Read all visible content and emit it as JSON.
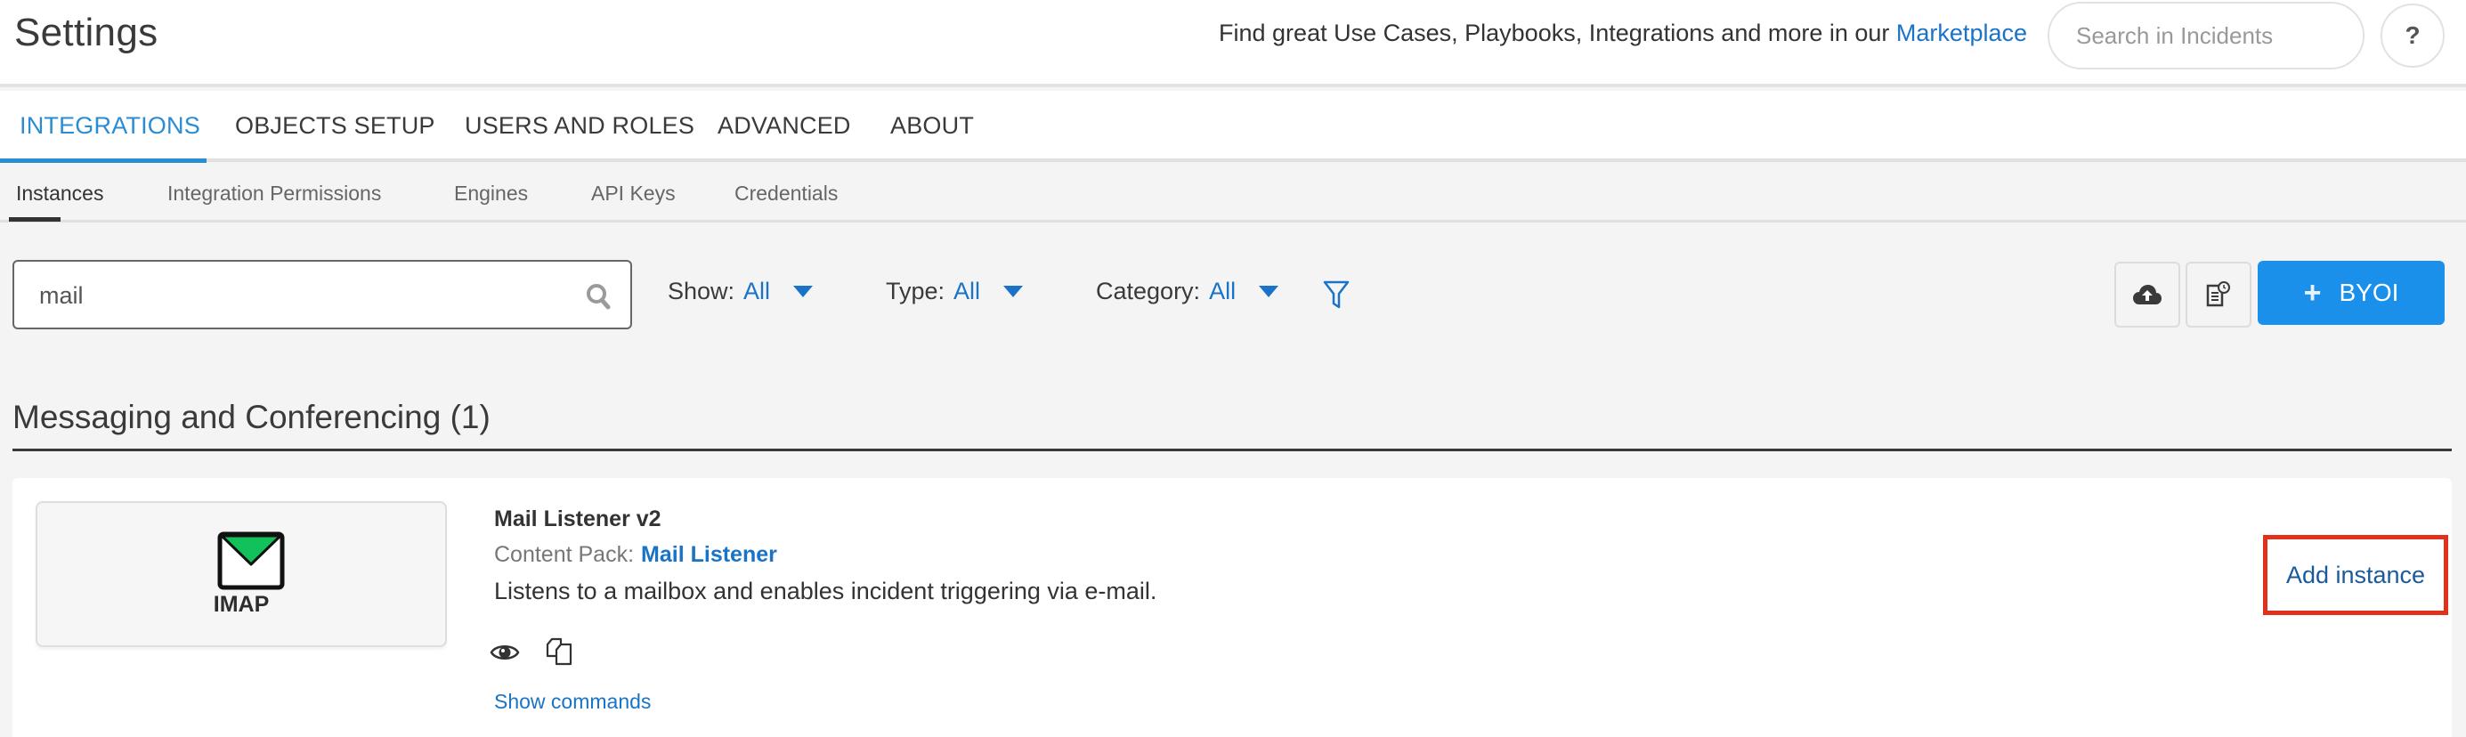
{
  "header": {
    "title": "Settings",
    "promo_text": "Find great Use Cases, Playbooks, Integrations and more in our ",
    "promo_link": "Marketplace",
    "search_placeholder": "Search in Incidents",
    "help_label": "?"
  },
  "main_tabs": [
    {
      "label": "INTEGRATIONS",
      "active": true
    },
    {
      "label": "OBJECTS SETUP",
      "active": false
    },
    {
      "label": "USERS AND ROLES",
      "active": false
    },
    {
      "label": "ADVANCED",
      "active": false
    },
    {
      "label": "ABOUT",
      "active": false
    }
  ],
  "sub_tabs": [
    {
      "label": "Instances",
      "active": true
    },
    {
      "label": "Integration Permissions",
      "active": false
    },
    {
      "label": "Engines",
      "active": false
    },
    {
      "label": "API Keys",
      "active": false
    },
    {
      "label": "Credentials",
      "active": false
    }
  ],
  "filters": {
    "search_value": "mail",
    "show": {
      "label": "Show:",
      "value": "All"
    },
    "type": {
      "label": "Type:",
      "value": "All"
    },
    "category": {
      "label": "Category:",
      "value": "All"
    }
  },
  "toolbar": {
    "upload_icon": "cloud-upload-icon",
    "changelog_icon": "document-clock-icon",
    "byoi_label": "BYOI",
    "byoi_icon": "plus-icon"
  },
  "section": {
    "title": "Messaging and Conferencing (1)"
  },
  "integration": {
    "logo_label": "IMAP",
    "name": "Mail Listener v2",
    "content_pack_label": "Content Pack:",
    "content_pack_link": "Mail Listener",
    "description": "Listens to a mailbox and enables incident triggering via e-mail.",
    "show_commands": "Show commands",
    "add_instance": "Add instance"
  },
  "colors": {
    "accent": "#2a8dd4",
    "link": "#1a73c7",
    "primary_button": "#1a90ea",
    "highlight_border": "#e0311a",
    "envelope_flap": "#12c15a"
  }
}
